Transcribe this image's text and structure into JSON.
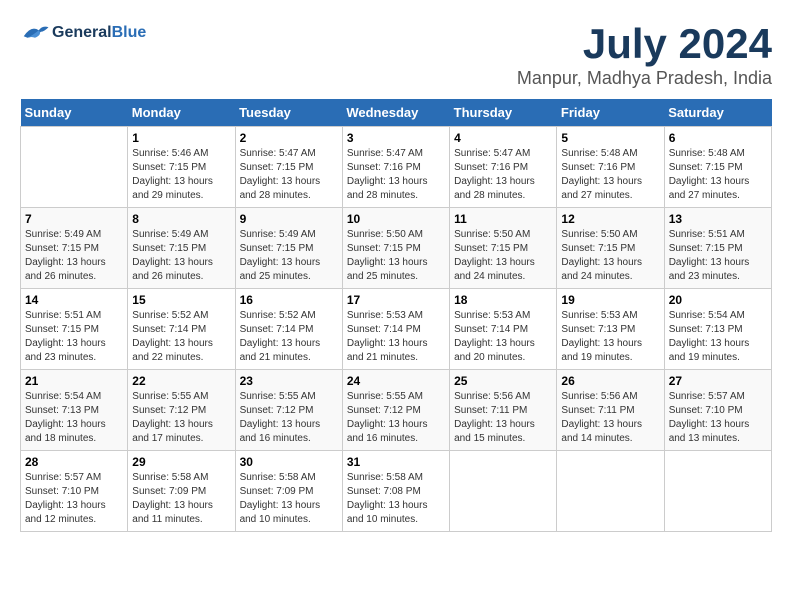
{
  "header": {
    "logo_general": "General",
    "logo_blue": "Blue",
    "month": "July 2024",
    "location": "Manpur, Madhya Pradesh, India"
  },
  "calendar": {
    "days_of_week": [
      "Sunday",
      "Monday",
      "Tuesday",
      "Wednesday",
      "Thursday",
      "Friday",
      "Saturday"
    ],
    "weeks": [
      [
        {
          "day": "",
          "sunrise": "",
          "sunset": "",
          "daylight": ""
        },
        {
          "day": "1",
          "sunrise": "Sunrise: 5:46 AM",
          "sunset": "Sunset: 7:15 PM",
          "daylight": "Daylight: 13 hours and 29 minutes."
        },
        {
          "day": "2",
          "sunrise": "Sunrise: 5:47 AM",
          "sunset": "Sunset: 7:15 PM",
          "daylight": "Daylight: 13 hours and 28 minutes."
        },
        {
          "day": "3",
          "sunrise": "Sunrise: 5:47 AM",
          "sunset": "Sunset: 7:16 PM",
          "daylight": "Daylight: 13 hours and 28 minutes."
        },
        {
          "day": "4",
          "sunrise": "Sunrise: 5:47 AM",
          "sunset": "Sunset: 7:16 PM",
          "daylight": "Daylight: 13 hours and 28 minutes."
        },
        {
          "day": "5",
          "sunrise": "Sunrise: 5:48 AM",
          "sunset": "Sunset: 7:16 PM",
          "daylight": "Daylight: 13 hours and 27 minutes."
        },
        {
          "day": "6",
          "sunrise": "Sunrise: 5:48 AM",
          "sunset": "Sunset: 7:15 PM",
          "daylight": "Daylight: 13 hours and 27 minutes."
        }
      ],
      [
        {
          "day": "7",
          "sunrise": "Sunrise: 5:49 AM",
          "sunset": "Sunset: 7:15 PM",
          "daylight": "Daylight: 13 hours and 26 minutes."
        },
        {
          "day": "8",
          "sunrise": "Sunrise: 5:49 AM",
          "sunset": "Sunset: 7:15 PM",
          "daylight": "Daylight: 13 hours and 26 minutes."
        },
        {
          "day": "9",
          "sunrise": "Sunrise: 5:49 AM",
          "sunset": "Sunset: 7:15 PM",
          "daylight": "Daylight: 13 hours and 25 minutes."
        },
        {
          "day": "10",
          "sunrise": "Sunrise: 5:50 AM",
          "sunset": "Sunset: 7:15 PM",
          "daylight": "Daylight: 13 hours and 25 minutes."
        },
        {
          "day": "11",
          "sunrise": "Sunrise: 5:50 AM",
          "sunset": "Sunset: 7:15 PM",
          "daylight": "Daylight: 13 hours and 24 minutes."
        },
        {
          "day": "12",
          "sunrise": "Sunrise: 5:50 AM",
          "sunset": "Sunset: 7:15 PM",
          "daylight": "Daylight: 13 hours and 24 minutes."
        },
        {
          "day": "13",
          "sunrise": "Sunrise: 5:51 AM",
          "sunset": "Sunset: 7:15 PM",
          "daylight": "Daylight: 13 hours and 23 minutes."
        }
      ],
      [
        {
          "day": "14",
          "sunrise": "Sunrise: 5:51 AM",
          "sunset": "Sunset: 7:15 PM",
          "daylight": "Daylight: 13 hours and 23 minutes."
        },
        {
          "day": "15",
          "sunrise": "Sunrise: 5:52 AM",
          "sunset": "Sunset: 7:14 PM",
          "daylight": "Daylight: 13 hours and 22 minutes."
        },
        {
          "day": "16",
          "sunrise": "Sunrise: 5:52 AM",
          "sunset": "Sunset: 7:14 PM",
          "daylight": "Daylight: 13 hours and 21 minutes."
        },
        {
          "day": "17",
          "sunrise": "Sunrise: 5:53 AM",
          "sunset": "Sunset: 7:14 PM",
          "daylight": "Daylight: 13 hours and 21 minutes."
        },
        {
          "day": "18",
          "sunrise": "Sunrise: 5:53 AM",
          "sunset": "Sunset: 7:14 PM",
          "daylight": "Daylight: 13 hours and 20 minutes."
        },
        {
          "day": "19",
          "sunrise": "Sunrise: 5:53 AM",
          "sunset": "Sunset: 7:13 PM",
          "daylight": "Daylight: 13 hours and 19 minutes."
        },
        {
          "day": "20",
          "sunrise": "Sunrise: 5:54 AM",
          "sunset": "Sunset: 7:13 PM",
          "daylight": "Daylight: 13 hours and 19 minutes."
        }
      ],
      [
        {
          "day": "21",
          "sunrise": "Sunrise: 5:54 AM",
          "sunset": "Sunset: 7:13 PM",
          "daylight": "Daylight: 13 hours and 18 minutes."
        },
        {
          "day": "22",
          "sunrise": "Sunrise: 5:55 AM",
          "sunset": "Sunset: 7:12 PM",
          "daylight": "Daylight: 13 hours and 17 minutes."
        },
        {
          "day": "23",
          "sunrise": "Sunrise: 5:55 AM",
          "sunset": "Sunset: 7:12 PM",
          "daylight": "Daylight: 13 hours and 16 minutes."
        },
        {
          "day": "24",
          "sunrise": "Sunrise: 5:55 AM",
          "sunset": "Sunset: 7:12 PM",
          "daylight": "Daylight: 13 hours and 16 minutes."
        },
        {
          "day": "25",
          "sunrise": "Sunrise: 5:56 AM",
          "sunset": "Sunset: 7:11 PM",
          "daylight": "Daylight: 13 hours and 15 minutes."
        },
        {
          "day": "26",
          "sunrise": "Sunrise: 5:56 AM",
          "sunset": "Sunset: 7:11 PM",
          "daylight": "Daylight: 13 hours and 14 minutes."
        },
        {
          "day": "27",
          "sunrise": "Sunrise: 5:57 AM",
          "sunset": "Sunset: 7:10 PM",
          "daylight": "Daylight: 13 hours and 13 minutes."
        }
      ],
      [
        {
          "day": "28",
          "sunrise": "Sunrise: 5:57 AM",
          "sunset": "Sunset: 7:10 PM",
          "daylight": "Daylight: 13 hours and 12 minutes."
        },
        {
          "day": "29",
          "sunrise": "Sunrise: 5:58 AM",
          "sunset": "Sunset: 7:09 PM",
          "daylight": "Daylight: 13 hours and 11 minutes."
        },
        {
          "day": "30",
          "sunrise": "Sunrise: 5:58 AM",
          "sunset": "Sunset: 7:09 PM",
          "daylight": "Daylight: 13 hours and 10 minutes."
        },
        {
          "day": "31",
          "sunrise": "Sunrise: 5:58 AM",
          "sunset": "Sunset: 7:08 PM",
          "daylight": "Daylight: 13 hours and 10 minutes."
        },
        {
          "day": "",
          "sunrise": "",
          "sunset": "",
          "daylight": ""
        },
        {
          "day": "",
          "sunrise": "",
          "sunset": "",
          "daylight": ""
        },
        {
          "day": "",
          "sunrise": "",
          "sunset": "",
          "daylight": ""
        }
      ]
    ]
  }
}
